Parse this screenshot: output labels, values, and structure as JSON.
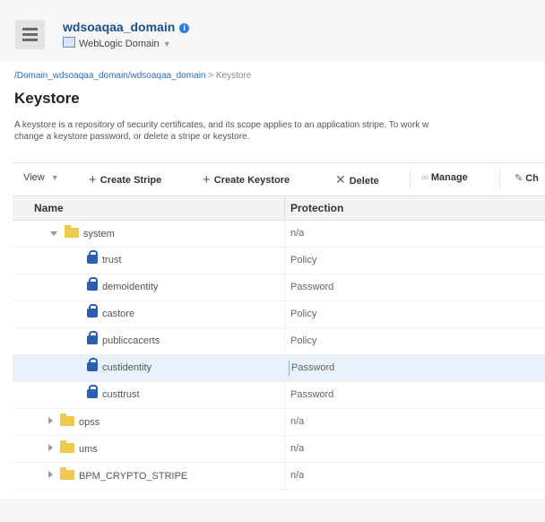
{
  "header": {
    "title": "wdsoaqaa_domain",
    "info_icon": "i",
    "subtitle": "WebLogic Domain",
    "subtitle_caret": "▼"
  },
  "breadcrumb": {
    "link": "/Domain_wdsoaqaa_domain/wdsoaqaa_domain",
    "separator": " > ",
    "current": "Keystore"
  },
  "page": {
    "title": "Keystore",
    "description_line1": "A keystore is a repository of security certificates, and its scope applies to an application stripe. To work w",
    "description_line2": "change a keystore password, or delete a stripe or keystore."
  },
  "toolbar": {
    "view_label": "View",
    "view_caret": "▼",
    "create_stripe_label": "Create Stripe",
    "create_keystore_label": "Create Keystore",
    "delete_label": "Delete",
    "manage_label": "Manage",
    "truncated_label": "Ch"
  },
  "table": {
    "columns": {
      "name": "Name",
      "protection": "Protection"
    },
    "rows": [
      {
        "name": "system",
        "protection": "n/a"
      },
      {
        "name": "trust",
        "protection": "Policy"
      },
      {
        "name": "demoidentity",
        "protection": "Password"
      },
      {
        "name": "castore",
        "protection": "Policy"
      },
      {
        "name": "publiccacerts",
        "protection": "Policy"
      },
      {
        "name": "custidentity",
        "protection": "Password"
      },
      {
        "name": "custtrust",
        "protection": "Password"
      },
      {
        "name": "opss",
        "protection": "n/a"
      },
      {
        "name": "ums",
        "protection": "n/a"
      },
      {
        "name": "BPM_CRYPTO_STRIPE",
        "protection": "n/a"
      }
    ]
  },
  "colors": {
    "title_blue": "#1a4f8c",
    "link_blue": "#2f6db5",
    "selected_row": "#e9f1fb",
    "lock_blue": "#2a5fb0",
    "folder_yellow": "#f1c94c"
  }
}
